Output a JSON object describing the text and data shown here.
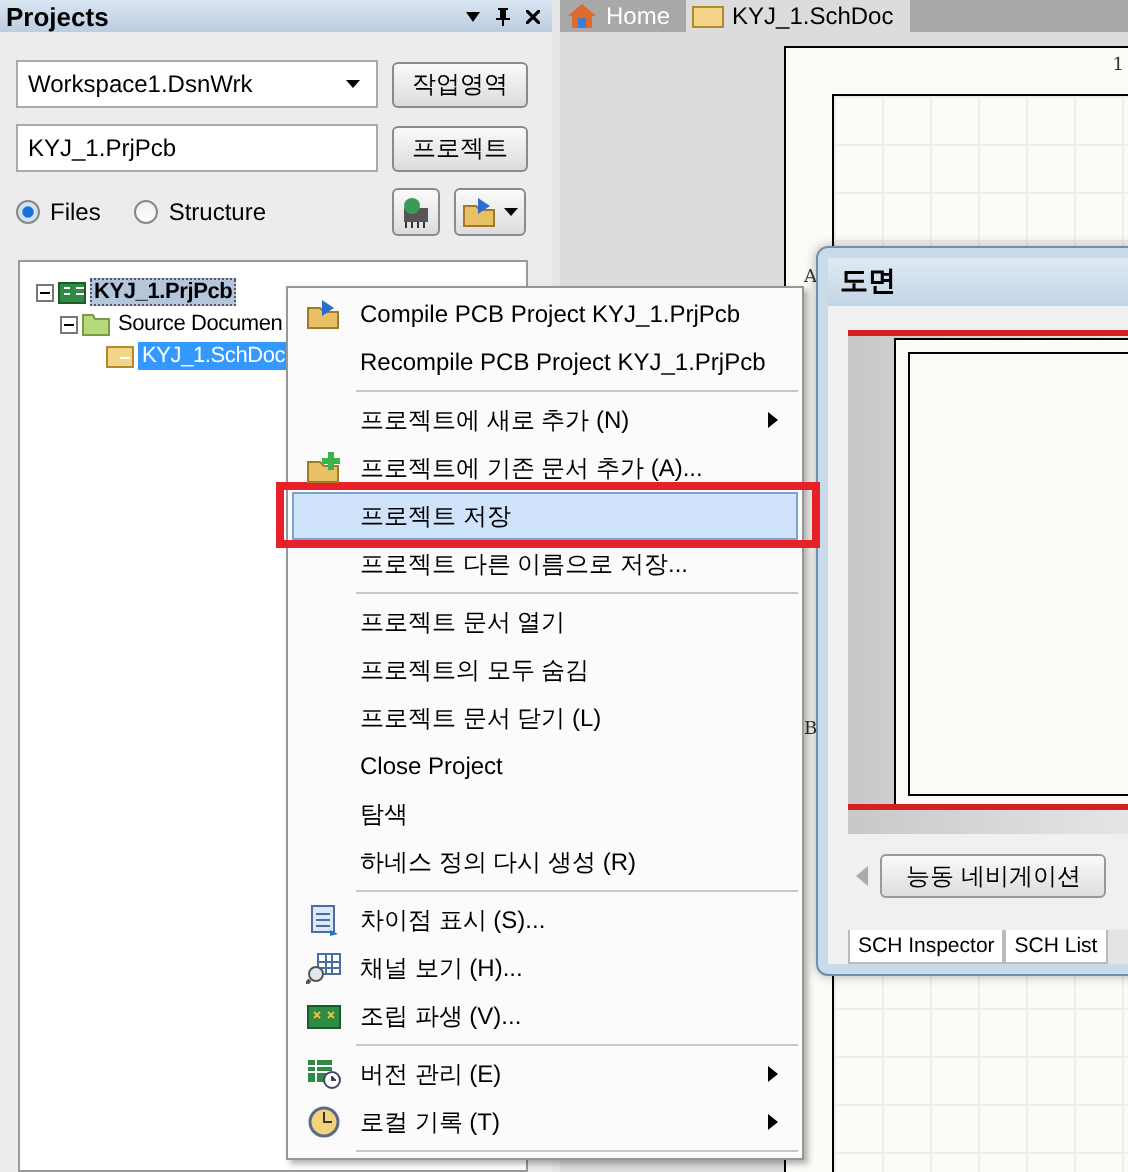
{
  "panel": {
    "title": "Projects",
    "workspace": "Workspace1.DsnWrk",
    "workspace_button": "작업영역",
    "project": "KYJ_1.PrjPcb",
    "project_button": "프로젝트",
    "view_options": [
      {
        "label": "Files",
        "selected": true
      },
      {
        "label": "Structure",
        "selected": false
      }
    ],
    "tree": [
      {
        "label": "KYJ_1.PrjPcb",
        "kind": "project",
        "selected": true,
        "expanded": true,
        "children": [
          {
            "label": "Source Documen",
            "kind": "folder",
            "selected": false,
            "expanded": true,
            "children": [
              {
                "label": "KYJ_1.SchDoc",
                "kind": "document",
                "selected": true
              }
            ]
          }
        ]
      }
    ]
  },
  "tabs": [
    {
      "label": "Home",
      "kind": "home",
      "selected": false
    },
    {
      "label": "KYJ_1.SchDoc",
      "kind": "document",
      "selected": true
    }
  ],
  "sheet": {
    "border_labels": [
      "1",
      "A",
      "B"
    ]
  },
  "navigator": {
    "title": "도면",
    "nav_button": "능동 네비게이션",
    "tabs": [
      "SCH Inspector",
      "SCH List"
    ]
  },
  "context_menu": {
    "items": [
      {
        "kind": "compile",
        "label": "Compile PCB Project KYJ_1.PrjPcb",
        "submenu": false,
        "selected": false
      },
      {
        "kind": "plain",
        "label": "Recompile PCB Project KYJ_1.PrjPcb",
        "submenu": false,
        "selected": false
      },
      {
        "kind": "separator"
      },
      {
        "kind": "plain",
        "label": "프로젝트에 새로 추가 (N)",
        "submenu": true,
        "selected": false
      },
      {
        "kind": "add",
        "label": "프로젝트에 기존 문서 추가 (A)...",
        "submenu": false,
        "selected": false
      },
      {
        "kind": "plain",
        "label": "프로젝트 저장",
        "submenu": false,
        "selected": true
      },
      {
        "kind": "plain",
        "label": "프로젝트 다른 이름으로 저장...",
        "submenu": false,
        "selected": false
      },
      {
        "kind": "separator"
      },
      {
        "kind": "plain",
        "label": "프로젝트 문서 열기",
        "submenu": false,
        "selected": false
      },
      {
        "kind": "plain",
        "label": "프로젝트의 모두 숨김",
        "submenu": false,
        "selected": false
      },
      {
        "kind": "plain",
        "label": "프로젝트 문서 닫기 (L)",
        "submenu": false,
        "selected": false
      },
      {
        "kind": "plain",
        "label": "Close Project",
        "submenu": false,
        "selected": false
      },
      {
        "kind": "plain",
        "label": "탐색",
        "submenu": false,
        "selected": false
      },
      {
        "kind": "plain",
        "label": "하네스 정의 다시 생성 (R)",
        "submenu": false,
        "selected": false
      },
      {
        "kind": "separator"
      },
      {
        "kind": "compare",
        "label": "차이점 표시 (S)...",
        "submenu": false,
        "selected": false
      },
      {
        "kind": "channels",
        "label": "채널 보기 (H)...",
        "submenu": false,
        "selected": false
      },
      {
        "kind": "board",
        "label": "조립 파생 (V)...",
        "submenu": false,
        "selected": false
      },
      {
        "kind": "separator"
      },
      {
        "kind": "version",
        "label": "버전 관리 (E)",
        "submenu": true,
        "selected": false
      },
      {
        "kind": "clock",
        "label": "로컬 기록 (T)",
        "submenu": true,
        "selected": false
      },
      {
        "kind": "separator"
      }
    ]
  }
}
